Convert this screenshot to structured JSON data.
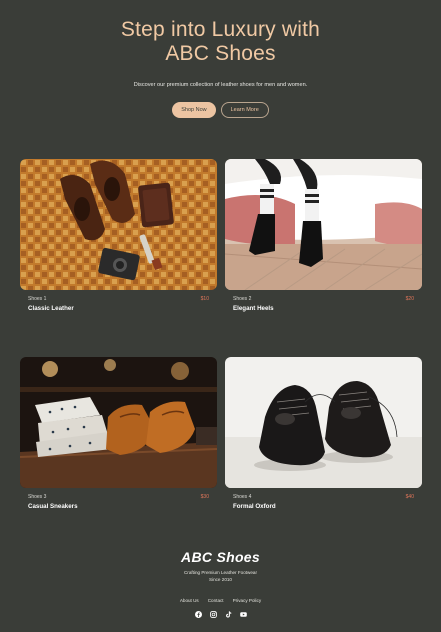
{
  "hero": {
    "title_line1": "Step into Luxury with",
    "title_line2": "ABC Shoes",
    "subtitle": "Discover our premium collection of leather shoes for men and women.",
    "primary_button": "Shop Now",
    "secondary_button": "Learn More"
  },
  "products": [
    {
      "category": "Shoes 1",
      "price": "$10",
      "name": "Classic Leather",
      "image": "brown brogues on patterned rug with wallet and camera"
    },
    {
      "category": "Shoes 2",
      "price": "$20",
      "name": "Elegant Heels",
      "image": "black ankle boots with striped socks on bed"
    },
    {
      "category": "Shoes 3",
      "price": "$30",
      "name": "Casual Sneakers",
      "image": "tan leather shoes on shelf with folded shirts"
    },
    {
      "category": "Shoes 4",
      "price": "$40",
      "name": "Formal Oxford",
      "image": "black oxford shoes on white background"
    }
  ],
  "footer": {
    "brand": "ABC Shoes",
    "tagline": "Crafting Premium Leather Footwear",
    "since": "Since 2010",
    "links": [
      "About Us",
      "Contact",
      "Privacy Policy"
    ],
    "social": [
      "facebook-icon",
      "instagram-icon",
      "tiktok-icon",
      "youtube-icon"
    ]
  },
  "colors": {
    "background": "#3a3d38",
    "accent": "#ecc4a2",
    "price": "#e0765a"
  }
}
